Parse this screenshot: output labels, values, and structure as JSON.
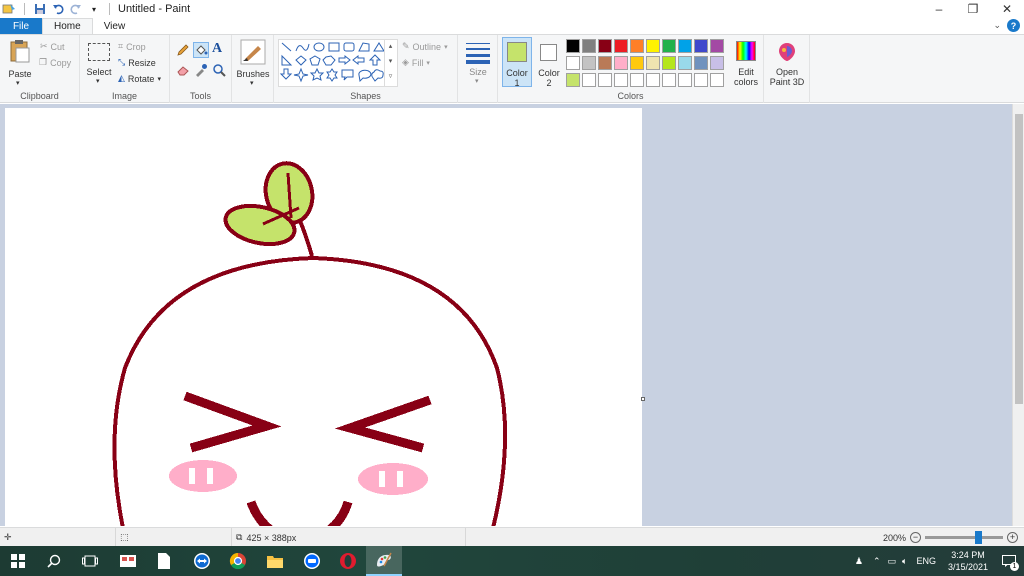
{
  "window": {
    "title": "Untitled - Paint",
    "controls": [
      "–",
      "❐",
      "✕"
    ]
  },
  "tabs": [
    {
      "label": "File"
    },
    {
      "label": "Home"
    },
    {
      "label": "View"
    }
  ],
  "ribbon": {
    "clipboard": {
      "group_label": "Clipboard",
      "paste": "Paste",
      "cut": "Cut",
      "copy": "Copy"
    },
    "image": {
      "group_label": "Image",
      "select": "Select",
      "crop": "Crop",
      "resize": "Resize",
      "rotate": "Rotate"
    },
    "tools": {
      "group_label": "Tools"
    },
    "brushes": {
      "label": "Brushes"
    },
    "shapes": {
      "group_label": "Shapes",
      "outline": "Outline",
      "fill": "Fill"
    },
    "size": {
      "label": "Size"
    },
    "colors": {
      "group_label": "Colors",
      "color1_label": "Color",
      "color1_num": "1",
      "color2_label": "Color",
      "color2_num": "2",
      "color1": "#c5e36b",
      "color2": "#ffffff",
      "edit_colors_l1": "Edit",
      "edit_colors_l2": "colors",
      "palette_row1": [
        "#000000",
        "#7f7f7f",
        "#880015",
        "#ed1c24",
        "#ff7f27",
        "#fff200",
        "#22b14c",
        "#00a2e8",
        "#3f48cc",
        "#a349a4"
      ],
      "palette_row2": [
        "#ffffff",
        "#c3c3c3",
        "#b97a57",
        "#ffaec9",
        "#ffc90e",
        "#efe4b0",
        "#b5e61d",
        "#99d9ea",
        "#7092be",
        "#c8bfe7"
      ],
      "palette_row3": [
        "#c5e36b",
        "#ffffff",
        "#ffffff",
        "#ffffff",
        "#ffffff",
        "#ffffff",
        "#ffffff",
        "#ffffff",
        "#ffffff",
        "#ffffff"
      ]
    },
    "paint3d": {
      "label_l1": "Open",
      "label_l2": "Paint 3D"
    }
  },
  "drawing": {
    "stroke": "#880015",
    "leaf": "#c5e36b",
    "cheek": "#ffaec9"
  },
  "statusbar": {
    "dimensions": "425 × 388px",
    "zoom": "200%"
  },
  "taskbar": {
    "lang": "ENG",
    "time": "3:24 PM",
    "date": "3/15/2021",
    "notification_count": "1"
  }
}
